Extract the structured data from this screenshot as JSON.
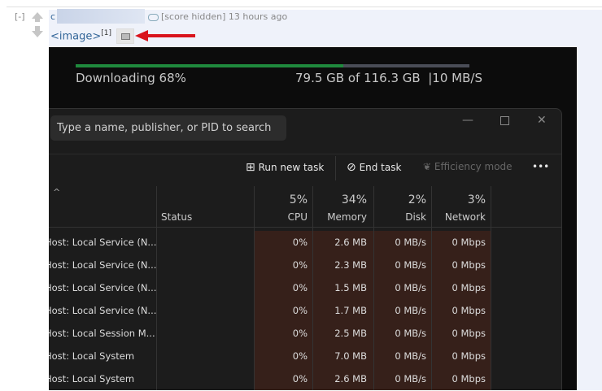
{
  "comment": {
    "collapse": "[-]",
    "author_initial": "c",
    "meta": "[score hidden] 13 hours ago",
    "link": "<image>",
    "footnote": "[1]",
    "annotation_color": "#d9141c"
  },
  "screenshot": {
    "download": {
      "label": "Downloading 68%",
      "progress": 0.68,
      "size": "79.5 GB of 116.3 GB",
      "speed": "|10 MB/S"
    },
    "task_manager": {
      "search_placeholder": "Type a name, publisher, or PID to search",
      "toolbar": {
        "run": "Run new task",
        "end": "End task",
        "efficiency": "Efficiency mode",
        "more": "•••"
      },
      "columns": {
        "status": "Status",
        "cpu_pct": "5%",
        "cpu": "CPU",
        "mem_pct": "34%",
        "mem": "Memory",
        "disk_pct": "2%",
        "disk": "Disk",
        "net_pct": "3%",
        "net": "Network"
      },
      "rows": [
        {
          "name": "Host: Local Service (N...",
          "cpu": "0%",
          "mem": "2.6 MB",
          "disk": "0 MB/s",
          "net": "0 Mbps"
        },
        {
          "name": "Host: Local Service (N...",
          "cpu": "0%",
          "mem": "2.3 MB",
          "disk": "0 MB/s",
          "net": "0 Mbps"
        },
        {
          "name": "Host: Local Service (N...",
          "cpu": "0%",
          "mem": "1.5 MB",
          "disk": "0 MB/s",
          "net": "0 Mbps"
        },
        {
          "name": "Host: Local Service (N...",
          "cpu": "0%",
          "mem": "1.7 MB",
          "disk": "0 MB/s",
          "net": "0 Mbps"
        },
        {
          "name": "Host: Local Session M...",
          "cpu": "0%",
          "mem": "2.5 MB",
          "disk": "0 MB/s",
          "net": "0 Mbps"
        },
        {
          "name": "Host: Local System",
          "cpu": "0%",
          "mem": "7.0 MB",
          "disk": "0 MB/s",
          "net": "0 Mbps"
        },
        {
          "name": "Host: Local System",
          "cpu": "0%",
          "mem": "2.6 MB",
          "disk": "0 MB/s",
          "net": "0 Mbps"
        }
      ]
    }
  }
}
